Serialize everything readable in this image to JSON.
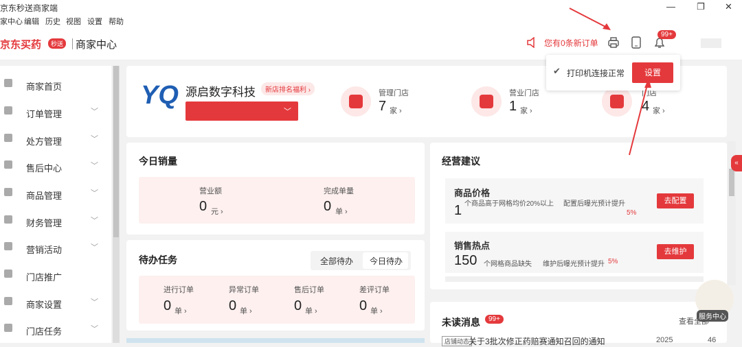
{
  "window": {
    "title": "京东秒送商家端",
    "min": "—",
    "max": "❐",
    "close": "✕"
  },
  "menu": [
    "家中心",
    "编辑",
    "历史",
    "视图",
    "设置",
    "帮助"
  ],
  "header": {
    "brand": "京东买药",
    "brand_badge": "秒送",
    "brand_sub": "商家中心",
    "order_alert": "您有0条新订单",
    "bell_badge": "99+"
  },
  "sidebar": {
    "items": [
      {
        "label": "商家首页",
        "chevron": false
      },
      {
        "label": "订单管理",
        "chevron": true
      },
      {
        "label": "处方管理",
        "chevron": true
      },
      {
        "label": "售后中心",
        "chevron": true
      },
      {
        "label": "商品管理",
        "chevron": true
      },
      {
        "label": "财务管理",
        "chevron": true
      },
      {
        "label": "营销活动",
        "chevron": true
      },
      {
        "label": "门店推广",
        "chevron": false
      },
      {
        "label": "商家设置",
        "chevron": true
      },
      {
        "label": "门店任务",
        "chevron": true
      }
    ]
  },
  "store": {
    "logo": "YQ",
    "name": "源启数字科技",
    "badge": "新店排名福利 ›",
    "stats": [
      {
        "label": "管理门店",
        "value": "7",
        "unit": "家 ›"
      },
      {
        "label": "营业门店",
        "value": "1",
        "unit": "家 ›"
      },
      {
        "label": "门店",
        "value": "4",
        "unit": "家 ›"
      }
    ]
  },
  "today": {
    "title": "今日销量",
    "metrics": [
      {
        "label": "营业额",
        "value": "0",
        "unit": "元 ›"
      },
      {
        "label": "完成单量",
        "value": "0",
        "unit": "单 ›"
      }
    ]
  },
  "todo": {
    "title": "待办任务",
    "tabs": [
      "全部待办",
      "今日待办"
    ],
    "metrics": [
      {
        "label": "进行订单",
        "value": "0",
        "unit": "单 ›"
      },
      {
        "label": "异常订单",
        "value": "0",
        "unit": "单 ›"
      },
      {
        "label": "售后订单",
        "value": "0",
        "unit": "单 ›"
      },
      {
        "label": "差评订单",
        "value": "0",
        "unit": "单 ›"
      }
    ]
  },
  "advice": {
    "title": "经营建议",
    "cards": [
      {
        "title": "商品价格",
        "num": "1",
        "desc": "个商品高于网格均价20%以上",
        "note": "配置后曝光预计提升",
        "pct": "5%",
        "button": "去配置"
      },
      {
        "title": "销售热点",
        "num": "150",
        "desc": "个网格商品缺失",
        "note": "维护后曝光预计提升",
        "pct": "5%",
        "button": "去维护"
      }
    ]
  },
  "messages": {
    "title": "未读消息",
    "badge": "99+",
    "more": "查看全部",
    "item": "关于3批次修正药赔赛通知召回的通知",
    "tag": "店铺动态",
    "date": "2025",
    "count": "46"
  },
  "popup": {
    "text": "打印机连接正常",
    "button": "设置"
  },
  "service": {
    "label": "服务中心"
  },
  "sidetab": "«"
}
